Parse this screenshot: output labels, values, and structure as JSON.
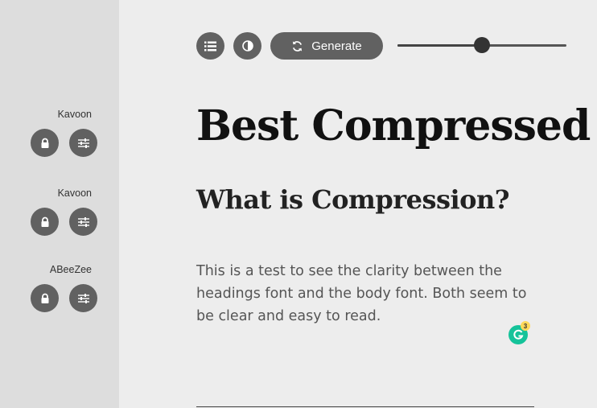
{
  "sidebar": {
    "font_groups": [
      {
        "font_name": "Kavoon",
        "lock_icon": "lock-icon",
        "settings_icon": "sliders-icon"
      },
      {
        "font_name": "Kavoon",
        "lock_icon": "lock-icon",
        "settings_icon": "sliders-icon"
      },
      {
        "font_name": "ABeeZee",
        "lock_icon": "lock-icon",
        "settings_icon": "sliders-icon"
      }
    ]
  },
  "toolbar": {
    "list_icon": "list-icon",
    "contrast_icon": "contrast-icon",
    "generate_icon": "refresh-icon",
    "generate_label": "Generate",
    "font_size_slider": {
      "value_fraction": 0.5
    }
  },
  "preview": {
    "heading1": "Best Compressed",
    "heading2": "What is Compression?",
    "body": "This is a test to see the clarity between the headings font and the body font. Both seem to be clear and easy to read."
  },
  "grammarly": {
    "icon": "grammarly-icon",
    "badge_count": "3",
    "color": "#15c39a"
  },
  "colors": {
    "sidebar_bg": "#dddddd",
    "main_bg": "#ededed",
    "button_bg": "#616161"
  }
}
